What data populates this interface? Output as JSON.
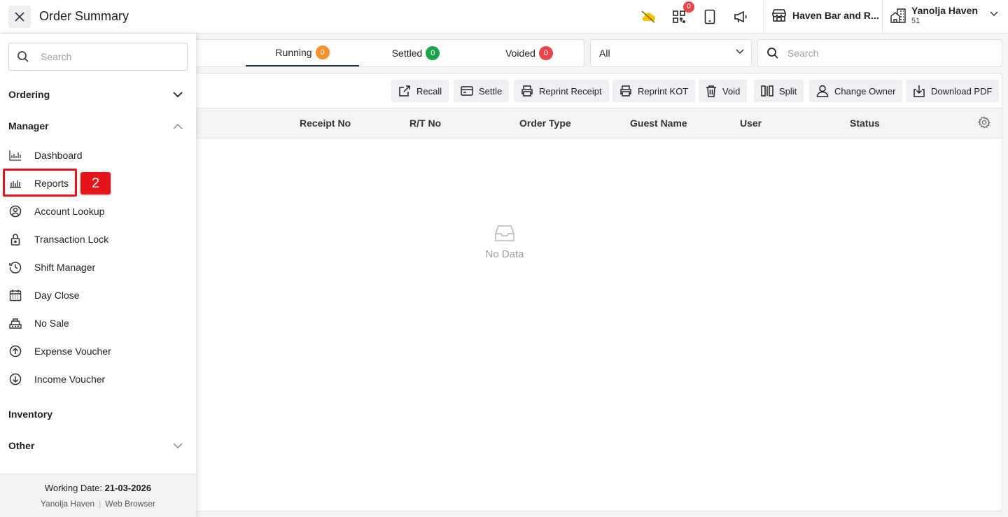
{
  "header": {
    "title": "Order Summary",
    "notification_count": "0",
    "outlet_name": "Haven Bar and R...",
    "property_name": "Yanolja Haven",
    "property_sub": "51"
  },
  "tabs": [
    {
      "label": "Running",
      "count": "0",
      "color": "#f5922e"
    },
    {
      "label": "Settled",
      "count": "0",
      "color": "#1aa34a"
    },
    {
      "label": "Voided",
      "count": "0",
      "color": "#e8464a"
    }
  ],
  "filter": {
    "selected": "All"
  },
  "search": {
    "placeholder": "Search"
  },
  "toolbar": {
    "recall": "Recall",
    "settle": "Settle",
    "reprint_receipt": "Reprint Receipt",
    "reprint_kot": "Reprint KOT",
    "void": "Void",
    "split": "Split",
    "change_owner": "Change Owner",
    "download_pdf": "Download PDF"
  },
  "table": {
    "columns": [
      "Receipt No",
      "R/T No",
      "Order Type",
      "Guest Name",
      "User",
      "Status"
    ],
    "empty_text": "No Data"
  },
  "sidebar": {
    "search_placeholder": "Search",
    "sections": {
      "ordering": "Ordering",
      "manager": "Manager",
      "inventory": "Inventory",
      "other": "Other"
    },
    "items": [
      {
        "label": "Dashboard",
        "icon": "dashboard-chart-icon"
      },
      {
        "label": "Reports",
        "icon": "bar-chart-icon"
      },
      {
        "label": "Account Lookup",
        "icon": "user-circle-icon"
      },
      {
        "label": "Transaction Lock",
        "icon": "lock-icon"
      },
      {
        "label": "Shift Manager",
        "icon": "clock-icon"
      },
      {
        "label": "Day Close",
        "icon": "calendar-icon"
      },
      {
        "label": "No Sale",
        "icon": "cash-register-icon"
      },
      {
        "label": "Expense Voucher",
        "icon": "arrow-up-circle-icon"
      },
      {
        "label": "Income Voucher",
        "icon": "arrow-down-circle-icon"
      }
    ],
    "step_marker": "2",
    "footer": {
      "working_date_label": "Working Date:",
      "working_date": "21-03-2026",
      "property": "Yanolja Haven",
      "separator": "|",
      "client": "Web Browser"
    }
  },
  "colors": {
    "accent": "#1f2a37",
    "highlight": "#e5141b"
  }
}
